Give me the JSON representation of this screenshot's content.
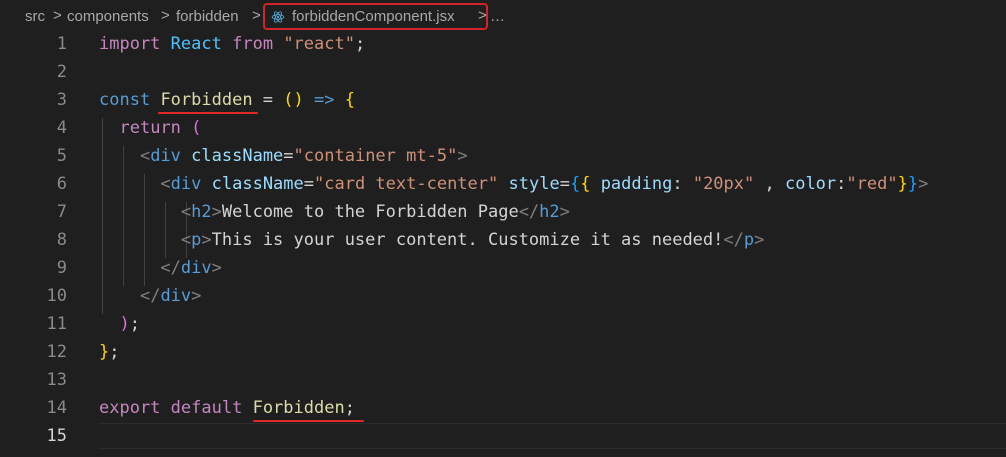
{
  "breadcrumb": {
    "items": [
      "src",
      "components",
      "forbidden"
    ],
    "file": "forbiddenComponent.jsx",
    "overflow": "…",
    "separator": ">"
  },
  "editor": {
    "active_line": 15,
    "lines": [
      {
        "n": "1",
        "tokens": [
          [
            "kw2",
            "import"
          ],
          [
            "text",
            " "
          ],
          [
            "var",
            "React"
          ],
          [
            "text",
            " "
          ],
          [
            "kw2",
            "from"
          ],
          [
            "text",
            " "
          ],
          [
            "str",
            "\"react\""
          ],
          [
            "text",
            ";"
          ]
        ]
      },
      {
        "n": "2",
        "tokens": []
      },
      {
        "n": "3",
        "tokens": [
          [
            "kw",
            "const"
          ],
          [
            "text",
            " "
          ],
          [
            "fn",
            "Forbidden"
          ],
          [
            "text",
            " = "
          ],
          [
            "br1",
            "()"
          ],
          [
            "text",
            " "
          ],
          [
            "kw",
            "=>"
          ],
          [
            "text",
            " "
          ],
          [
            "br1",
            "{"
          ]
        ]
      },
      {
        "n": "4",
        "tokens": [
          [
            "text",
            "  "
          ],
          [
            "kw2",
            "return"
          ],
          [
            "text",
            " "
          ],
          [
            "br2",
            "("
          ]
        ]
      },
      {
        "n": "5",
        "tokens": [
          [
            "text",
            "    "
          ],
          [
            "punc",
            "<"
          ],
          [
            "tag",
            "div"
          ],
          [
            "text",
            " "
          ],
          [
            "attr",
            "className"
          ],
          [
            "text",
            "="
          ],
          [
            "str",
            "\"container mt-5\""
          ],
          [
            "punc",
            ">"
          ]
        ]
      },
      {
        "n": "6",
        "tokens": [
          [
            "text",
            "      "
          ],
          [
            "punc",
            "<"
          ],
          [
            "tag",
            "div"
          ],
          [
            "text",
            " "
          ],
          [
            "attr",
            "className"
          ],
          [
            "text",
            "="
          ],
          [
            "str",
            "\"card text-center\""
          ],
          [
            "text",
            " "
          ],
          [
            "attr",
            "style"
          ],
          [
            "text",
            "="
          ],
          [
            "br3",
            "{"
          ],
          [
            "br1",
            "{"
          ],
          [
            "text",
            " "
          ],
          [
            "attr",
            "padding"
          ],
          [
            "text",
            ": "
          ],
          [
            "str",
            "\"20px\""
          ],
          [
            "text",
            " , "
          ],
          [
            "attr",
            "color"
          ],
          [
            "text",
            ":"
          ],
          [
            "str",
            "\"red\""
          ],
          [
            "br1",
            "}"
          ],
          [
            "br3",
            "}"
          ],
          [
            "punc",
            ">"
          ]
        ]
      },
      {
        "n": "7",
        "tokens": [
          [
            "text",
            "        "
          ],
          [
            "punc",
            "<"
          ],
          [
            "tag",
            "h2"
          ],
          [
            "punc",
            ">"
          ],
          [
            "text",
            "Welcome to the Forbidden Page"
          ],
          [
            "punc",
            "</"
          ],
          [
            "tag",
            "h2"
          ],
          [
            "punc",
            ">"
          ]
        ]
      },
      {
        "n": "8",
        "tokens": [
          [
            "text",
            "        "
          ],
          [
            "punc",
            "<"
          ],
          [
            "tag",
            "p"
          ],
          [
            "punc",
            ">"
          ],
          [
            "text",
            "This is your user content. Customize it as needed!"
          ],
          [
            "punc",
            "</"
          ],
          [
            "tag",
            "p"
          ],
          [
            "punc",
            ">"
          ]
        ]
      },
      {
        "n": "9",
        "tokens": [
          [
            "text",
            "      "
          ],
          [
            "punc",
            "</"
          ],
          [
            "tag",
            "div"
          ],
          [
            "punc",
            ">"
          ]
        ]
      },
      {
        "n": "10",
        "tokens": [
          [
            "text",
            "    "
          ],
          [
            "punc",
            "</"
          ],
          [
            "tag",
            "div"
          ],
          [
            "punc",
            ">"
          ]
        ]
      },
      {
        "n": "11",
        "tokens": [
          [
            "text",
            "  "
          ],
          [
            "br2",
            ")"
          ],
          [
            "text",
            ";"
          ]
        ]
      },
      {
        "n": "12",
        "tokens": [
          [
            "br1",
            "}"
          ],
          [
            "text",
            ";"
          ]
        ]
      },
      {
        "n": "13",
        "tokens": []
      },
      {
        "n": "14",
        "tokens": [
          [
            "kw2",
            "export"
          ],
          [
            "text",
            " "
          ],
          [
            "kw2",
            "default"
          ],
          [
            "text",
            " "
          ],
          [
            "fn",
            "Forbidden"
          ],
          [
            "text",
            ";"
          ]
        ]
      },
      {
        "n": "15",
        "tokens": []
      }
    ]
  },
  "colors": {
    "background": "#1f1f1f",
    "annotation": "#e02a2a"
  }
}
